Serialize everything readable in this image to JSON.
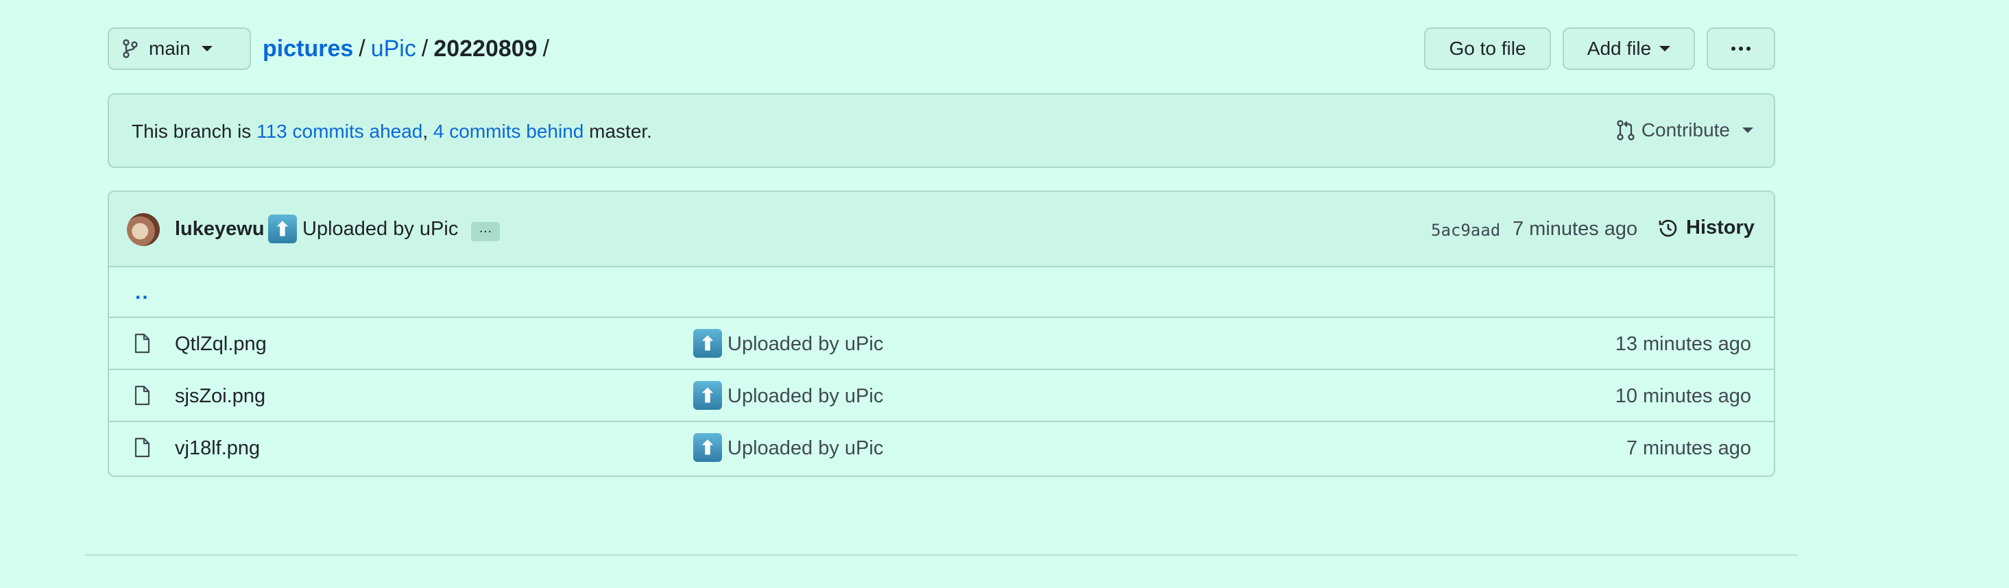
{
  "toolbar": {
    "branch": "main",
    "go_to_file": "Go to file",
    "add_file": "Add file"
  },
  "breadcrumb": {
    "repo": "pictures",
    "folder": "uPic",
    "current": "20220809",
    "sep": "/"
  },
  "branch_info": {
    "prefix": "This branch is ",
    "ahead": "113 commits ahead",
    "comma": ", ",
    "behind": "4 commits behind",
    "suffix": " master.",
    "contribute": "Contribute"
  },
  "latest_commit": {
    "author": "lukeyewu",
    "emoji": "⬆",
    "message": "Uploaded by uPic",
    "ellipsis": "…",
    "sha": "5ac9aad",
    "time": "7 minutes ago",
    "history": "History"
  },
  "parent_dir": "..",
  "files": [
    {
      "name": "QtlZql.png",
      "emoji": "⬆",
      "message": "Uploaded by uPic",
      "age": "13 minutes ago"
    },
    {
      "name": "sjsZoi.png",
      "emoji": "⬆",
      "message": "Uploaded by uPic",
      "age": "10 minutes ago"
    },
    {
      "name": "vj18lf.png",
      "emoji": "⬆",
      "message": "Uploaded by uPic",
      "age": "7 minutes ago"
    }
  ],
  "icons": {
    "branch": "git-branch-icon",
    "pull_request": "git-pull-request-icon",
    "history": "history-clock-icon",
    "file": "file-icon",
    "more": "kebab-horizontal-icon"
  },
  "colors": {
    "background": "#d4fef0",
    "panel": "#cbf6e7",
    "border": "#a9d8c8",
    "link": "#0969da"
  }
}
